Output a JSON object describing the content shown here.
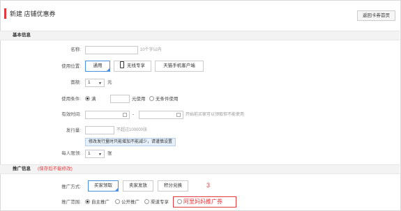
{
  "header": {
    "title": "新建 店铺优惠券",
    "back_button": "返回卡券首页"
  },
  "section_basic": {
    "title": "基本信息"
  },
  "name": {
    "label": "名称:",
    "value": "",
    "hint": "10个字以内"
  },
  "use_location": {
    "label": "使用位置:",
    "options": [
      "通用",
      "无线专享",
      "天猫手机客户端"
    ]
  },
  "denomination": {
    "label": "面额:",
    "value": "1",
    "unit": "元"
  },
  "condition": {
    "label": "使用条件:",
    "full_label": "满",
    "full_suffix": "元使用",
    "no_condition_label": "无条件使用"
  },
  "validity": {
    "label": "有效时间:",
    "separator": "-",
    "hint": "开始前买家可以领取但不能使用"
  },
  "quantity": {
    "label": "发行量:",
    "hint": "不超过100000张",
    "tip": "修改发行量时只能增加不能减少，请谨慎设置"
  },
  "limit": {
    "label": "每人限领:",
    "value": "1",
    "unit": "张"
  },
  "section_promo": {
    "title": "推广信息",
    "note": "(保存后不能修改)"
  },
  "promo_method": {
    "label": "推广方式:",
    "options": [
      "买家领取",
      "卖家发放",
      "积分兑换"
    ]
  },
  "promo_scope": {
    "label": "推广范围:",
    "options": [
      "自主推广",
      "公开推广",
      "渠道专享"
    ],
    "highlight_option": "阿里妈妈推广券"
  },
  "annotation": {
    "number": "3"
  },
  "colors": {
    "accent": "#e4393c",
    "selected_border": "#4a90e2"
  }
}
